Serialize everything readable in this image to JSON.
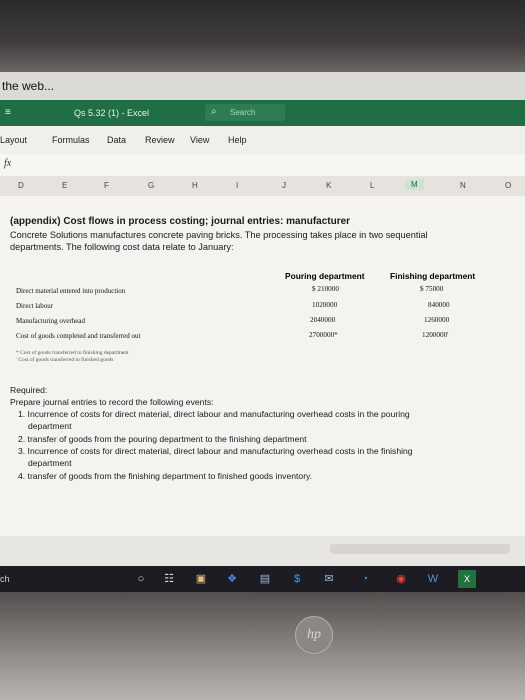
{
  "browser": {
    "tab_text": "the web..."
  },
  "excel": {
    "title": "Qs 5.32 (1) - Excel",
    "search_label": "Search",
    "ribbon_tabs": [
      "Layout",
      "Formulas",
      "Data",
      "Review",
      "View",
      "Help"
    ],
    "formula_icon": "fx",
    "columns": [
      "D",
      "E",
      "F",
      "G",
      "H",
      "I",
      "J",
      "K",
      "L",
      "M",
      "N",
      "O"
    ],
    "active_column": "M"
  },
  "content": {
    "title": "(appendix) Cost flows in process costing; journal entries: manufacturer",
    "intro_lines": [
      "Concrete Solutions manufactures concrete paving bricks. The processing takes place in two sequential",
      "departments. The following cost data relate to January:"
    ],
    "table": {
      "col1": "Pouring department",
      "col2": "Finishing department",
      "rows": [
        {
          "label": "Direct material entered into production",
          "v1": "$ 210000",
          "v2": "$  75000"
        },
        {
          "label": "Direct labour",
          "v1": "1020000",
          "v2": "840000"
        },
        {
          "label": "Manufacturing overhead",
          "v1": "2040000",
          "v2": "1260000"
        },
        {
          "label": "Cost of goods completed and transferred out",
          "v1": "2700000*",
          "v2": "1200000'"
        }
      ],
      "footnotes": [
        "* Cost of goods transferred to finishing department",
        "' Cost of goods transferred to finished goods"
      ]
    },
    "required_label": "Required:",
    "required_intro": "Prepare journal entries to record the following events:",
    "required_items": [
      "1. Incurrence of costs for direct material, direct labour and manufacturing overhead costs in the pouring",
      "department",
      "2. transfer of goods from the pouring department to the finishing department",
      "3. Incurrence of costs for direct material, direct labour and manufacturing overhead costs in the finishing",
      "department",
      "4. transfer of goods from the finishing department to finished goods inventory."
    ]
  },
  "taskbar": {
    "left_text": "ch",
    "icons": [
      "cortana-icon",
      "task-view-icon",
      "store-icon",
      "dropbox-icon",
      "photos-icon",
      "money-icon",
      "mail-icon",
      "edge-icon",
      "chrome-icon",
      "word-icon",
      "excel-icon"
    ]
  },
  "device": {
    "brand": "hp"
  }
}
